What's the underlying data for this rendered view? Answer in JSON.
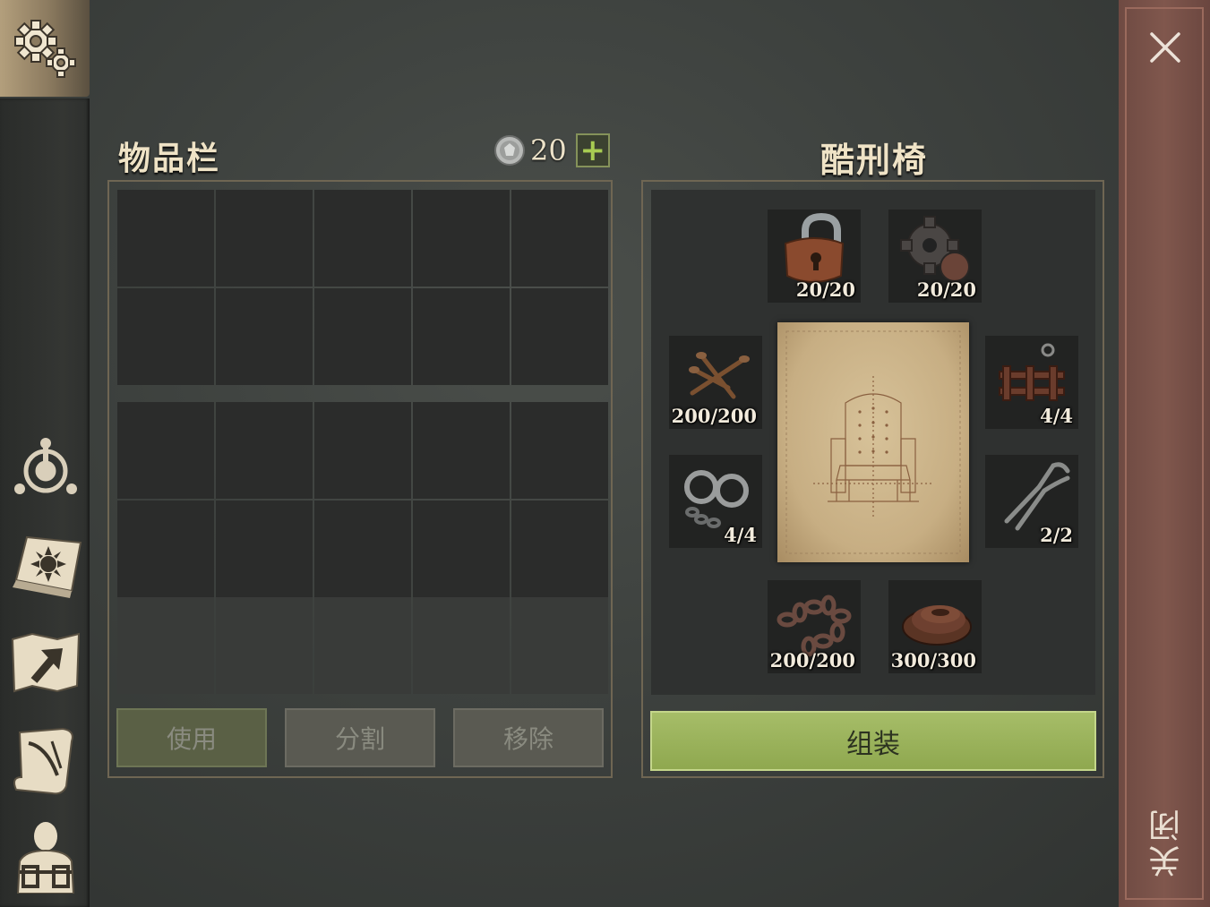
{
  "inventory": {
    "title": "物品栏",
    "currency_value": "20",
    "add_label": "+",
    "buttons": {
      "use": "使用",
      "split": "分割",
      "remove": "移除"
    }
  },
  "crafting": {
    "title": "酷刑椅",
    "assemble_label": "组装",
    "materials": [
      {
        "name": "padlock",
        "count": "20/20"
      },
      {
        "name": "gears",
        "count": "20/20"
      },
      {
        "name": "nails",
        "count": "200/200"
      },
      {
        "name": "wooden-frame",
        "count": "4/4"
      },
      {
        "name": "shackles",
        "count": "4/4"
      },
      {
        "name": "pincers",
        "count": "2/2"
      },
      {
        "name": "chain",
        "count": "200/200"
      },
      {
        "name": "leather-strap",
        "count": "300/300"
      }
    ]
  },
  "close": {
    "label": "关闭"
  },
  "icons": {
    "settings": "gears-icon",
    "sidebar": [
      "compass-icon",
      "journal-icon",
      "map-icon",
      "scroll-icon",
      "character-icon"
    ],
    "currency": "silver-coin-icon",
    "close": "close-x-icon"
  },
  "colors": {
    "accent_green": "#9fb65c",
    "close_strip": "#7a534a",
    "panel_border": "#6f6653"
  }
}
